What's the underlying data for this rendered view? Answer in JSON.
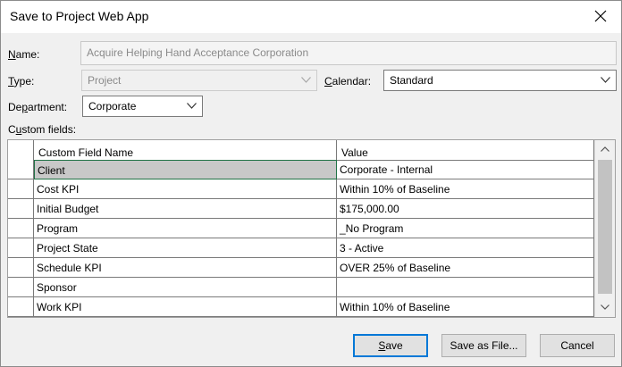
{
  "window": {
    "title": "Save to Project Web App"
  },
  "form": {
    "name_label": "Name:",
    "name_placeholder": "Acquire Helping Hand Acceptance Corporation",
    "type_label": "Type:",
    "type_value": "Project",
    "calendar_label": "Calendar:",
    "calendar_value": "Standard",
    "department_label": "Department:",
    "department_value": "Corporate",
    "custom_fields_label": "Custom fields:"
  },
  "grid": {
    "columns": [
      "Custom Field Name",
      "Value"
    ],
    "rows": [
      {
        "name": "Client",
        "value": "Corporate - Internal"
      },
      {
        "name": "Cost KPI",
        "value": "Within 10% of Baseline"
      },
      {
        "name": "Initial Budget",
        "value": "$175,000.00"
      },
      {
        "name": "Program",
        "value": "_No Program"
      },
      {
        "name": "Project State",
        "value": "3 - Active"
      },
      {
        "name": "Schedule KPI",
        "value": "OVER 25% of Baseline"
      },
      {
        "name": "Sponsor",
        "value": ""
      },
      {
        "name": "Work KPI",
        "value": "Within 10% of Baseline"
      }
    ]
  },
  "buttons": {
    "save": "Save",
    "save_as_file": "Save as File...",
    "cancel": "Cancel"
  },
  "colors": {
    "accent": "#0078d7",
    "selection_border": "#217346"
  },
  "icons": {
    "close": "close-icon",
    "dropdown": "chevron-down-icon",
    "scroll_up": "scroll-up-arrow-icon",
    "scroll_down": "scroll-down-arrow-icon"
  }
}
